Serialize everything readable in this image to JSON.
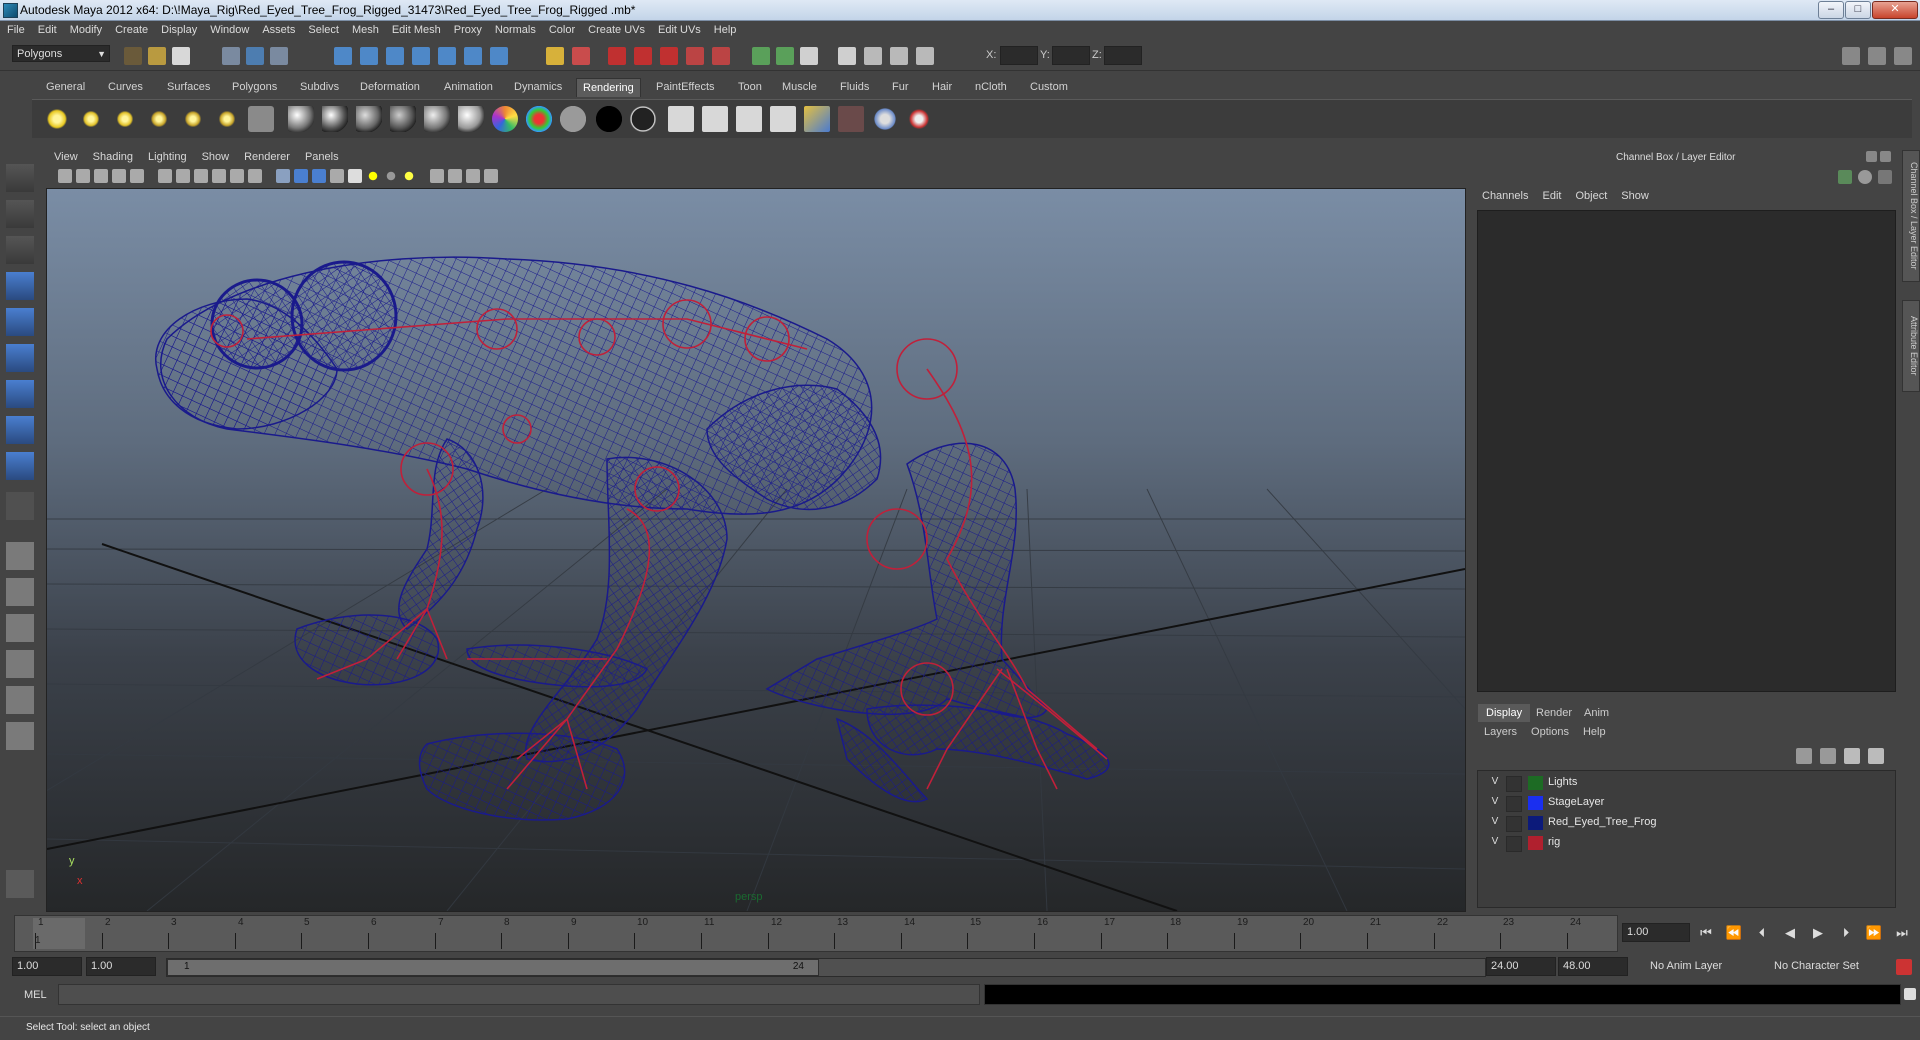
{
  "window": {
    "title": "Autodesk Maya 2012 x64: D:\\!Maya_Rig\\Red_Eyed_Tree_Frog_Rigged_31473\\Red_Eyed_Tree_Frog_Rigged .mb*",
    "min": "–",
    "max": "□",
    "close": "✕"
  },
  "menubar": [
    "File",
    "Edit",
    "Modify",
    "Create",
    "Display",
    "Window",
    "Assets",
    "Select",
    "Mesh",
    "Edit Mesh",
    "Proxy",
    "Normals",
    "Color",
    "Create UVs",
    "Edit UVs",
    "Help"
  ],
  "status_line": {
    "mode": "Polygons",
    "x_label": "X:",
    "y_label": "Y:",
    "z_label": "Z:"
  },
  "shelf": {
    "tabs": [
      "General",
      "Curves",
      "Surfaces",
      "Polygons",
      "Subdivs",
      "Deformation",
      "Animation",
      "Dynamics",
      "Rendering",
      "PaintEffects",
      "Toon",
      "Muscle",
      "Fluids",
      "Fur",
      "Hair",
      "nCloth",
      "Custom"
    ],
    "active_tab": "Rendering"
  },
  "viewport": {
    "menu": [
      "View",
      "Shading",
      "Lighting",
      "Show",
      "Renderer",
      "Panels"
    ],
    "camera": "persp",
    "axis_y": "y",
    "axis_x": "x"
  },
  "channel_box": {
    "title": "Channel Box / Layer Editor",
    "menu": [
      "Channels",
      "Edit",
      "Object",
      "Show"
    ],
    "side_tabs": [
      "Channel Box / Layer Editor",
      "Attribute Editor"
    ]
  },
  "layer_editor": {
    "tabs": [
      "Display",
      "Render",
      "Anim"
    ],
    "active_tab": "Display",
    "menu": [
      "Layers",
      "Options",
      "Help"
    ],
    "layers": [
      {
        "visible": "V",
        "name": "Lights",
        "color": "#1d6b24"
      },
      {
        "visible": "V",
        "name": "StageLayer",
        "color": "#1a2ff0"
      },
      {
        "visible": "V",
        "name": "Red_Eyed_Tree_Frog",
        "color": "#0c1a7a"
      },
      {
        "visible": "V",
        "name": "rig",
        "color": "#b0202e"
      }
    ]
  },
  "time_slider": {
    "ticks": [
      "1",
      "2",
      "3",
      "4",
      "5",
      "6",
      "7",
      "8",
      "9",
      "10",
      "11",
      "12",
      "13",
      "14",
      "15",
      "16",
      "17",
      "18",
      "19",
      "20",
      "21",
      "22",
      "23",
      "24"
    ],
    "current_frame_label": "1",
    "current_frame": "1.00"
  },
  "range_slider": {
    "start_time": "1.00",
    "playback_start": "1.00",
    "range_start_label": "1",
    "range_end_label": "24",
    "playback_end": "24.00",
    "end_time": "48.00",
    "anim_layer": "No Anim Layer",
    "character_set": "No Character Set"
  },
  "command_line": {
    "label": "MEL"
  },
  "help_line": {
    "text": "Select Tool: select an object"
  },
  "colors": {
    "wireframe": "#1a1a8c",
    "rig": "#c0203a",
    "grid": "#1a1a1a"
  }
}
